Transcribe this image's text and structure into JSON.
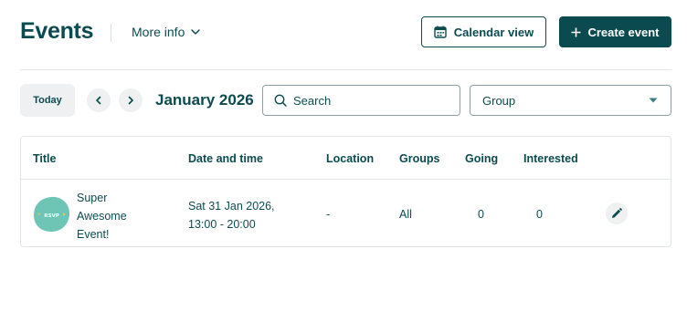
{
  "header": {
    "title": "Events",
    "more_info_label": "More info",
    "calendar_view_label": "Calendar view",
    "create_event_label": "Create event"
  },
  "toolbar": {
    "today_label": "Today",
    "month_label": "January 2026",
    "search_placeholder": "Search",
    "group_select_value": "Group"
  },
  "table": {
    "columns": {
      "title": "Title",
      "date_time": "Date and time",
      "location": "Location",
      "groups": "Groups",
      "going": "Going",
      "interested": "Interested"
    },
    "rows": [
      {
        "title_line1": "Super",
        "title_line2": "Awesome",
        "title_line3": "Event!",
        "thumb_text": "RSVP",
        "date_line1": "Sat 31 Jan 2026,",
        "date_line2": "13:00 - 20:00",
        "location": "-",
        "groups": "All",
        "going": "0",
        "interested": "0"
      }
    ]
  },
  "icons": {
    "more_info": "chevron-down-icon",
    "calendar": "calendar-icon",
    "create": "plus-icon",
    "prev": "chevron-left-icon",
    "next": "chevron-right-icon",
    "search": "search-icon",
    "dropdown": "caret-down-icon",
    "edit": "pencil-icon"
  },
  "colors": {
    "brand": "#0b4b50",
    "muted_bg": "#eef0f1",
    "border": "#e1e5e6",
    "thumb": "#6ec5b5"
  }
}
